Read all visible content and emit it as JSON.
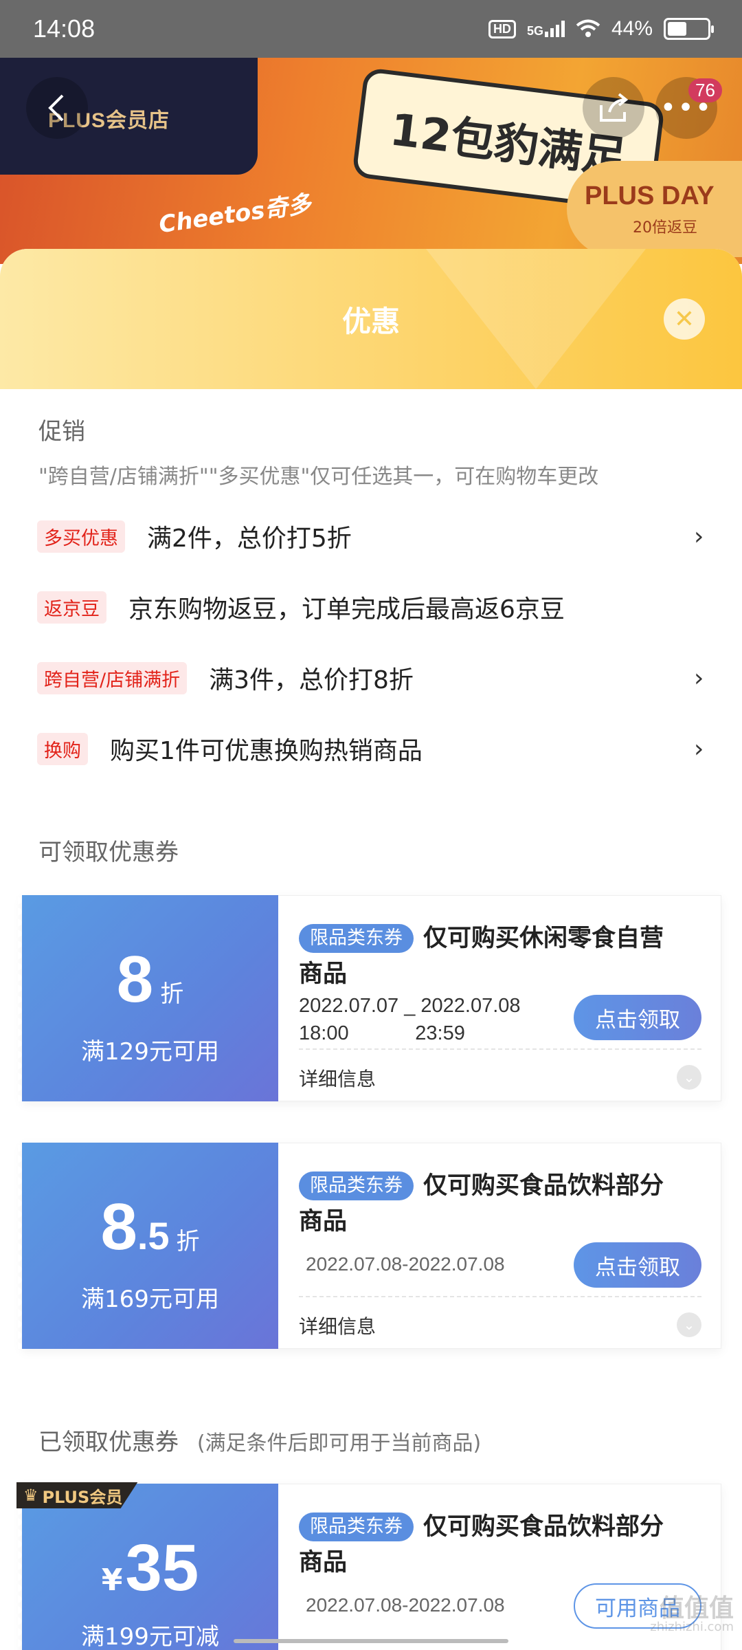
{
  "status_bar": {
    "time": "14:08",
    "hd": "HD",
    "network": "5G",
    "battery": "44%",
    "battery_level": 0.44
  },
  "banner": {
    "store_logo": "PLUS会员店",
    "product_text": "12包豹满足",
    "brand_text": "Cheetos奇多",
    "plusday_title": "PLUS DAY",
    "plusday_sub": "20倍返豆",
    "notification_count": "76",
    "icons": [
      "back-icon",
      "share-icon",
      "more-icon"
    ]
  },
  "sheet": {
    "title": "优惠",
    "close_icon": "close-icon"
  },
  "promotions": {
    "section_title": "促销",
    "note": "\"跨自营/店铺满折\"\"多买优惠\"仅可任选其一，可在购物车更改",
    "items": [
      {
        "tag": "多买优惠",
        "text": "满2件，总价打5折",
        "arrow": "›"
      },
      {
        "tag": "返京豆",
        "text": "京东购物返豆，订单完成后最高返6京豆",
        "arrow": ""
      },
      {
        "tag": "跨自营/店铺满折",
        "text": "满3件，总价打8折",
        "arrow": "›"
      },
      {
        "tag": "换购",
        "text": "购买1件可优惠换购热销商品",
        "arrow": "›"
      }
    ]
  },
  "available_coupons": {
    "section_title": "可领取优惠券",
    "coupons": [
      {
        "value_big": "8",
        "value_small": "",
        "unit": "折",
        "condition": "满129元可用",
        "tag": "限品类东券",
        "title": "仅可购买休闲零食自营商品",
        "date_line1": "2022.07.07 _ 2022.07.08",
        "date_line2": "18:00            23:59",
        "button": "点击领取",
        "detail": "详细信息"
      },
      {
        "value_big": "8",
        "value_small": ".5",
        "unit": "折",
        "condition": "满169元可用",
        "tag": "限品类东券",
        "title": "仅可购买食品饮料部分商品",
        "date": "2022.07.08-2022.07.08",
        "button": "点击领取",
        "detail": "详细信息"
      }
    ]
  },
  "claimed_coupons": {
    "section_title": "已领取优惠券",
    "section_note": "(满足条件后即可用于当前商品)",
    "coupons": [
      {
        "badge": "PLUS会员",
        "currency": "¥",
        "value": "35",
        "condition": "满199元可减",
        "tag": "限品类东券",
        "title": "仅可购买食品饮料部分商品",
        "date": "2022.07.08-2022.07.08",
        "button": "可用商品"
      }
    ]
  },
  "watermark": {
    "main": "值值值",
    "sub": "zhizhizhi.com"
  }
}
